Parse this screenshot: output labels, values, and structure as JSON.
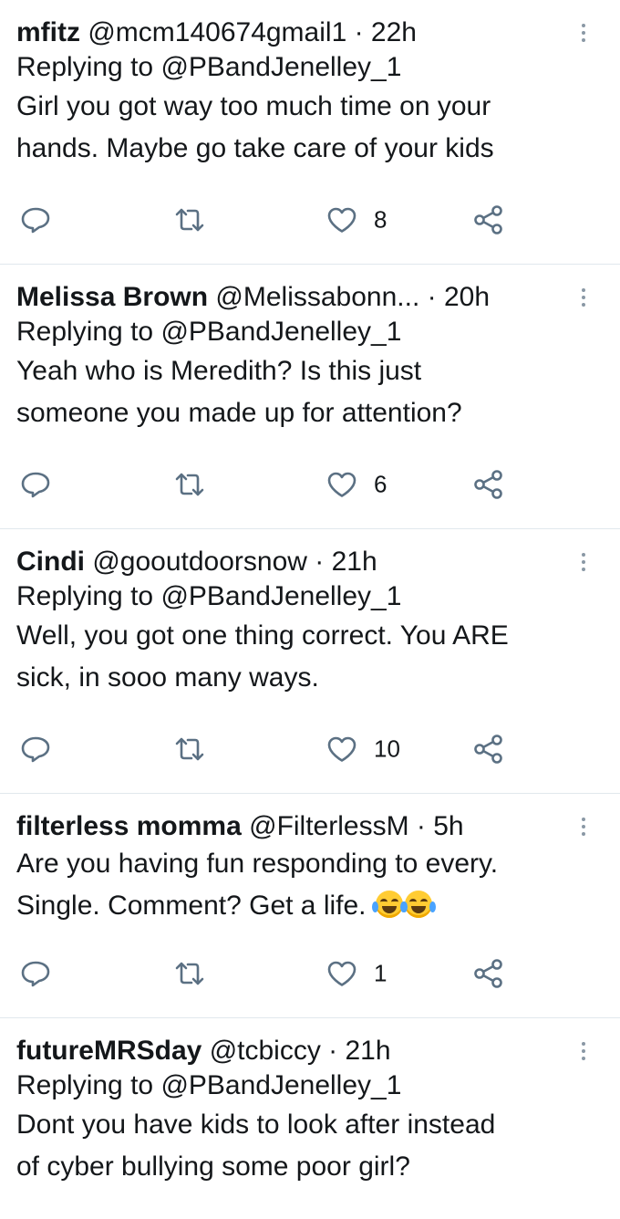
{
  "tweets": [
    {
      "name": "mfitz",
      "meta": " @mcm140674gmail1 · 22h",
      "replying_prefix": "Replying to ",
      "replying_handle": "@PBandJenelley_1",
      "text": "Girl you got way too much time on your\nhands. Maybe go take care of your kids",
      "likes": "8"
    },
    {
      "name": "Melissa Brown",
      "meta": " @Melissabonn... · 20h",
      "replying_prefix": "Replying to ",
      "replying_handle": "@PBandJenelley_1",
      "text": "Yeah who is Meredith? Is this just\nsomeone you made up for attention?",
      "likes": "6"
    },
    {
      "name": "Cindi",
      "meta": " @gooutdoorsnow · 21h",
      "replying_prefix": "Replying to ",
      "replying_handle": "@PBandJenelley_1",
      "text": "Well, you got one thing correct. You ARE\nsick, in sooo many ways.",
      "likes": "10"
    },
    {
      "name": "filterless momma",
      "meta": " @FilterlessM · 5h",
      "text": "Are you having fun responding to every.\nSingle. Comment? Get a life. ",
      "emoji": [
        "face-with-tears-of-joy-emoji",
        "face-with-tears-of-joy-emoji"
      ],
      "likes": "1"
    },
    {
      "name": "futureMRSday",
      "meta": " @tcbiccy · 21h",
      "replying_prefix": "Replying to ",
      "replying_handle": "@PBandJenelley_1",
      "text": "Dont you have kids to look after instead\nof cyber bullying some poor girl?"
    }
  ],
  "icons": {
    "reply": "reply-icon",
    "retweet": "retweet-icon",
    "like": "heart-icon",
    "share": "share-icon",
    "more": "more-vertical-icon"
  },
  "colors": {
    "icon": "#5b7083",
    "divider": "#e1e8ed",
    "text": "#14171a"
  }
}
